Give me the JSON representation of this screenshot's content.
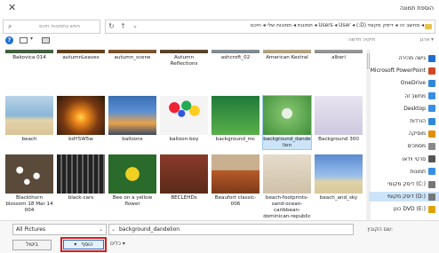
{
  "window": {
    "title": "הוספת תמונה",
    "close_glyph": "✕"
  },
  "address": {
    "path": "◂ מחשב זה ◂ דיסק מקומי (D:) ◂ Users ◂ User ◂ תמונות ◂ תמונות שלי ◂ חיכם",
    "dropdown_glyph": "⌄",
    "refresh_glyph": "↻",
    "up_glyph": "↑"
  },
  "search": {
    "placeholder": "חפש בתמונות חיכם"
  },
  "toolbar": {
    "organize_label": "ארגן ▾",
    "new_folder_label": "תיקיה חדשה",
    "help_glyph": "?"
  },
  "nav": [
    {
      "label": "גישה מהירה",
      "icon": "star-icon",
      "color": "#1e6fd0"
    },
    {
      "label": "Microsoft PowerPoint",
      "icon": "powerpoint-icon",
      "color": "#d24726"
    },
    {
      "label": "OneDrive",
      "icon": "cloud-icon",
      "color": "#2f88d8"
    },
    {
      "label": "מחשב זה",
      "icon": "computer-icon",
      "color": "#3a8ee6"
    },
    {
      "label": "Desktop",
      "icon": "desktop-icon",
      "color": "#3a8ee6"
    },
    {
      "label": "הורדות",
      "icon": "download-icon",
      "color": "#2f88d8"
    },
    {
      "label": "מוסיקה",
      "icon": "music-icon",
      "color": "#e09000"
    },
    {
      "label": "מסמכים",
      "icon": "documents-icon",
      "color": "#8a8a8a"
    },
    {
      "label": "סרטי וידאו",
      "icon": "video-icon",
      "color": "#555"
    },
    {
      "label": "תמונות",
      "icon": "pictures-icon",
      "color": "#3a8ee6"
    },
    {
      "label": "דיסק מקומי (C:)",
      "icon": "drive-icon",
      "color": "#777"
    },
    {
      "label": "דיסק מקומי (D:)",
      "icon": "drive-icon",
      "color": "#777",
      "selected": true
    },
    {
      "label": "כונן DVD (E:)",
      "icon": "dvd-icon",
      "color": "#e0a000"
    }
  ],
  "files": [
    {
      "name": "Bakovica 014",
      "bg": "linear-gradient(#5a7a4a,#3c5a3a)"
    },
    {
      "name": "autumnLeaves",
      "bg": "linear-gradient(#8a5a2a,#5a3a1a)"
    },
    {
      "name": "autumn_scene",
      "bg": "linear-gradient(#b87a3a,#6a4a2a)"
    },
    {
      "name": "Autumn Reflections",
      "bg": "linear-gradient(#9a6a3a,#4a3a2a)"
    },
    {
      "name": "ashcroft_02",
      "bg": "linear-gradient(#aab2b8,#7a8288)"
    },
    {
      "name": "American Kestral",
      "bg": "linear-gradient(#d8c8a8,#a89878)"
    },
    {
      "name": "alberi",
      "bg": "linear-gradient(#c8c8c8,#888)"
    },
    {
      "name": "beach",
      "bg": "linear-gradient(#b9d4e8 0%,#8bb6d6 50%,#e4d3a8 62%,#d8c498 100%)"
    },
    {
      "name": "bdYSW5w",
      "bg": "radial-gradient(circle at 50% 55%,#ffd64a 0%,#f08a1c 20%,#7a3a12 55%,#2a1a0a 100%)"
    },
    {
      "name": "balloons",
      "bg": "linear-gradient(#3b6fb3 0%,#5b8fd3 40%,#e9a24a 70%,#3a4a6a 100%)"
    },
    {
      "name": "balloon-boy",
      "bg": "radial-gradient(circle at 30% 30%,#e23 0 12%,transparent 13%),radial-gradient(circle at 55% 25%,#2a5 0 12%,transparent 13%),radial-gradient(circle at 72% 38%,#fc2 0 12%,transparent 13%),radial-gradient(circle at 45% 45%,#35d 0 10%,transparent 11%),#f4f4f4"
    },
    {
      "name": "background_mc",
      "bg": "linear-gradient(#1f7a3a,#5ab04a)"
    },
    {
      "name": "background_dandelion",
      "bg": "radial-gradient(circle at 50% 45%,#e8f0e8 0 16%,#7fbf6a 17%,#3f8f3a 100%)",
      "selected": true
    },
    {
      "name": "Background 300",
      "bg": "linear-gradient(#e8e4f0,#cfc8e0)"
    },
    {
      "name": "Blackthorn blossom 18 Mar 14 004",
      "bg": "radial-gradient(circle at 30% 40%,#fff 0 8%,transparent 9%),radial-gradient(circle at 65% 55%,#fff 0 8%,transparent 9%),radial-gradient(circle at 45% 70%,#fff 0 7%,transparent 8%),#5a4a3a"
    },
    {
      "name": "black-cars",
      "bg": "repeating-linear-gradient(90deg,#222 0 4px,#666 4px 6px)"
    },
    {
      "name": "Bee on a yellow flower",
      "bg": "radial-gradient(circle at 50% 50%,#f0d020 0 22%,#2a6a2a 23%)"
    },
    {
      "name": "BECLEHDs",
      "bg": "linear-gradient(#8a3a2a,#5a2a1a)"
    },
    {
      "name": "Beaufort classic-006",
      "bg": "linear-gradient(#c8b090 0%,#c8b090 40%,#b85a2a 41%,#7a3a1a 100%)"
    },
    {
      "name": "beach-footprints-sand-ocean-caribbean-dominican-republic",
      "bg": "linear-gradient(#e6dccb,#cfc1a8)"
    },
    {
      "name": "beach_and_sky",
      "bg": "linear-gradient(#5a8ad0 0%,#9ac0ea 55%,#e0d2a8 70%,#d8c89a 100%)"
    }
  ],
  "bottom": {
    "filter_value": "All Pictures",
    "filename_value": "background_dandelion",
    "filename_label": "שם הקובץ:",
    "insert_label": "הוסף",
    "cancel_label": "ביטול",
    "tools_label": "כלים ▾",
    "dropdown_glyph": "⌄"
  }
}
